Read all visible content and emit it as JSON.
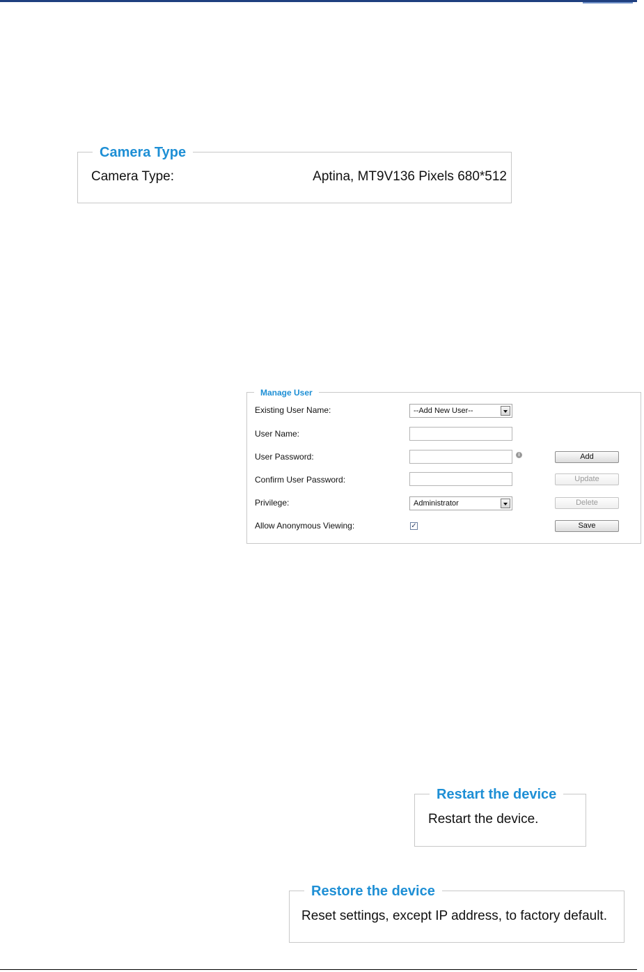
{
  "camera_type": {
    "legend": "Camera Type",
    "label": "Camera Type:",
    "value": "Aptina, MT9V136 Pixels 680*512"
  },
  "manage_user": {
    "legend": "Manage User",
    "existing_user_label": "Existing User Name:",
    "existing_user_value": "--Add New User--",
    "user_name_label": "User Name:",
    "user_name_value": "",
    "user_password_label": "User Password:",
    "user_password_value": "",
    "confirm_password_label": "Confirm User Password:",
    "confirm_password_value": "",
    "privilege_label": "Privilege:",
    "privilege_value": "Administrator",
    "anonymous_label": "Allow Anonymous Viewing:",
    "anonymous_checked": true,
    "buttons": {
      "add": "Add",
      "update": "Update",
      "delete": "Delete",
      "save": "Save"
    },
    "info_icon_glyph": "i",
    "check_glyph": "✓"
  },
  "restart": {
    "legend": "Restart the device",
    "text": "Restart the device."
  },
  "restore": {
    "legend": "Restore the device",
    "text": "Reset settings, except IP address, to factory default."
  },
  "colors": {
    "legend_blue": "#1e8fd5",
    "header_rule": "#1f3f7f"
  }
}
